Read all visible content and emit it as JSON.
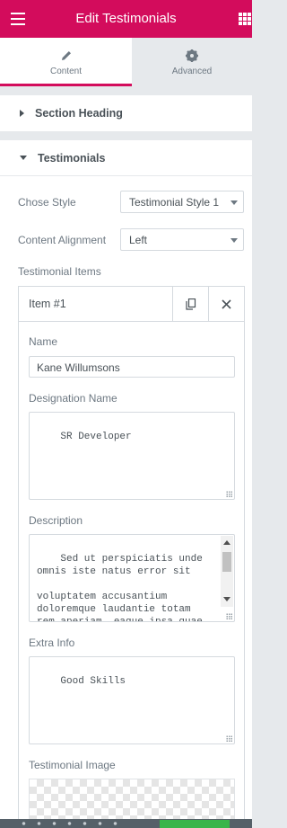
{
  "header": {
    "title": "Edit Testimonials"
  },
  "tabs": [
    {
      "label": "Content",
      "icon": "pencil-icon",
      "active": true
    },
    {
      "label": "Advanced",
      "icon": "gear-icon",
      "active": false
    }
  ],
  "sections": {
    "section_heading": {
      "label": "Section Heading",
      "expanded": false
    },
    "testimonials": {
      "label": "Testimonials",
      "expanded": true
    }
  },
  "controls": {
    "chose_style": {
      "label": "Chose Style",
      "value": "Testimonial Style 1"
    },
    "content_alignment": {
      "label": "Content Alignment",
      "value": "Left"
    },
    "items_label": "Testimonial Items"
  },
  "item": {
    "title": "Item #1",
    "name_label": "Name",
    "name_value": "Kane Willumsons",
    "designation_label": "Designation Name",
    "designation_value": "SR Developer",
    "description_label": "Description",
    "description_value": "Sed ut perspiciatis unde\nomnis iste natus error sit\n\nvoluptatem accusantium\ndoloremque laudantie totam\nrem aperiam, eaque ipsa quae\nab illo inventore veritatis",
    "extra_label": "Extra Info",
    "extra_value": "Good Skills",
    "image_label": "Testimonial Image"
  },
  "colors": {
    "brand": "#d30c5c",
    "publish": "#39b54a"
  }
}
